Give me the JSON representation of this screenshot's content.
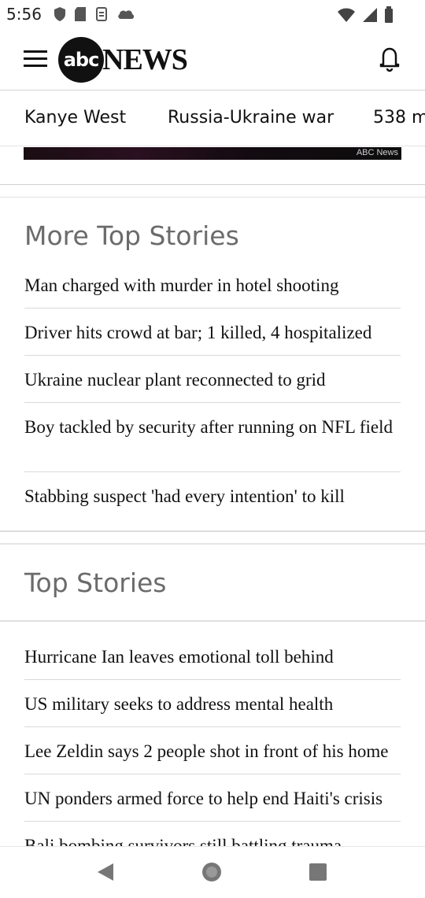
{
  "status_bar": {
    "time": "5:56"
  },
  "header": {
    "logo_abc": "abc",
    "logo_news": "NEWS"
  },
  "topics": [
    "Kanye West",
    "Russia-Ukraine war",
    "538 m"
  ],
  "media": {
    "credit": "ABC News"
  },
  "more_top_stories": {
    "title": "More Top Stories",
    "items": [
      "Man charged with murder in hotel shooting",
      "Driver hits crowd at bar; 1 killed, 4 hospitalized",
      "Ukraine nuclear plant reconnected to grid",
      "Boy tackled by security after running on NFL field",
      "Stabbing suspect 'had every intention' to kill"
    ]
  },
  "top_stories": {
    "title": "Top Stories",
    "items": [
      "Hurricane Ian leaves emotional toll behind",
      "US military seeks to address mental health",
      "Lee Zeldin says 2 people shot in front of his home",
      "UN ponders armed force to help end Haiti's crisis",
      "Bali bombing survivors still battling trauma"
    ]
  },
  "colors": {
    "section_title": "#6b6b6b",
    "rule": "#d9d9d9",
    "logo": "#111111"
  }
}
